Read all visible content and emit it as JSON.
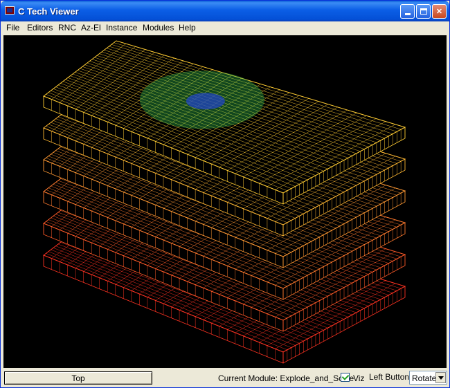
{
  "window": {
    "title": "C Tech Viewer"
  },
  "menu": [
    "File",
    "Editors",
    "RNC",
    "Az-El",
    "Instance",
    "Modules",
    "Help"
  ],
  "viewport": {
    "layer_count": 6,
    "layer_colors": [
      "#ffcc33",
      "#ffb833",
      "#ff9933",
      "#ff7a2e",
      "#ff5a28",
      "#ff3322"
    ],
    "highlight_colors": [
      "#33cc55",
      "#2244cc"
    ],
    "background": "#000000"
  },
  "status": {
    "top_button": "Top",
    "module_text": "Current Module: Explode_and_Scale",
    "viz_label": "Viz",
    "viz_checked": true,
    "left_button_label": "Left Button",
    "left_button_value": "Rotate"
  }
}
